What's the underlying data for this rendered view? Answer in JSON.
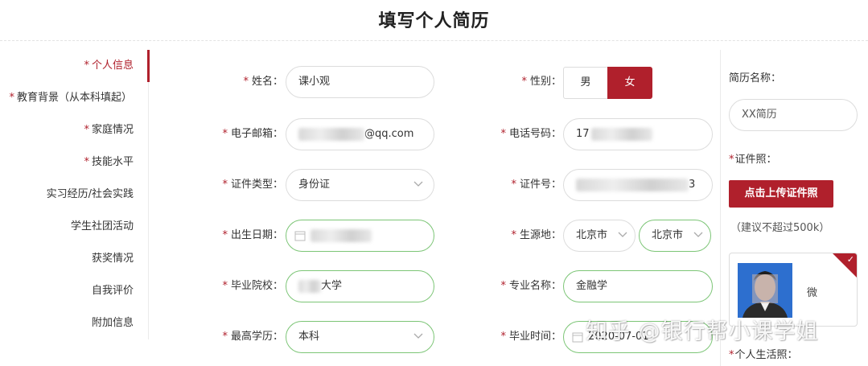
{
  "header": {
    "title": "填写个人简历"
  },
  "sidebar": {
    "items": [
      {
        "label": "个人信息",
        "required": "*"
      },
      {
        "label": "教育背景（从本科填起）",
        "required": "*"
      },
      {
        "label": "家庭情况",
        "required": "*"
      },
      {
        "label": "技能水平",
        "required": "*"
      },
      {
        "label": "实习经历/社会实践",
        "required": ""
      },
      {
        "label": "学生社团活动",
        "required": ""
      },
      {
        "label": "获奖情况",
        "required": ""
      },
      {
        "label": "自我评价",
        "required": ""
      },
      {
        "label": "附加信息",
        "required": ""
      }
    ]
  },
  "form": {
    "required_mark": "*",
    "name": {
      "label": "姓名：",
      "value": "课小观"
    },
    "gender": {
      "label": "性别：",
      "male": "男",
      "female": "女",
      "selected": "女"
    },
    "email": {
      "label": "电子邮箱：",
      "value_visible": "@qq.com",
      "prefix_visible": ""
    },
    "phone": {
      "label": "电话号码：",
      "value_visible": "17"
    },
    "id_type": {
      "label": "证件类型：",
      "value": "身份证"
    },
    "id_number": {
      "label": "证件号：",
      "value_visible": "3"
    },
    "birth_date": {
      "label": "出生日期：",
      "value_visible": ""
    },
    "origin": {
      "label": "生源地：",
      "province": "北京市",
      "city": "北京市"
    },
    "school": {
      "label": "毕业院校：",
      "value_visible": "大学"
    },
    "major": {
      "label": "专业名称：",
      "value": "金融学"
    },
    "degree": {
      "label": "最高学历：",
      "value": "本科"
    },
    "grad_time": {
      "label": "毕业时间：",
      "value": "2020-07-01"
    }
  },
  "right_panel": {
    "resume_name_label": "简历名称：",
    "resume_name_value": "XX简历",
    "id_photo_label": "证件照：",
    "upload_button": "点击上传证件照",
    "size_hint": "（建议不超过500k）",
    "photo_caption": "微",
    "life_photo_label": "个人生活照："
  },
  "watermark": "知乎 @银行帮小课学姐",
  "colors": {
    "accent": "#b0202c",
    "focus_border": "#7cc576",
    "border": "#dcdcdc"
  }
}
